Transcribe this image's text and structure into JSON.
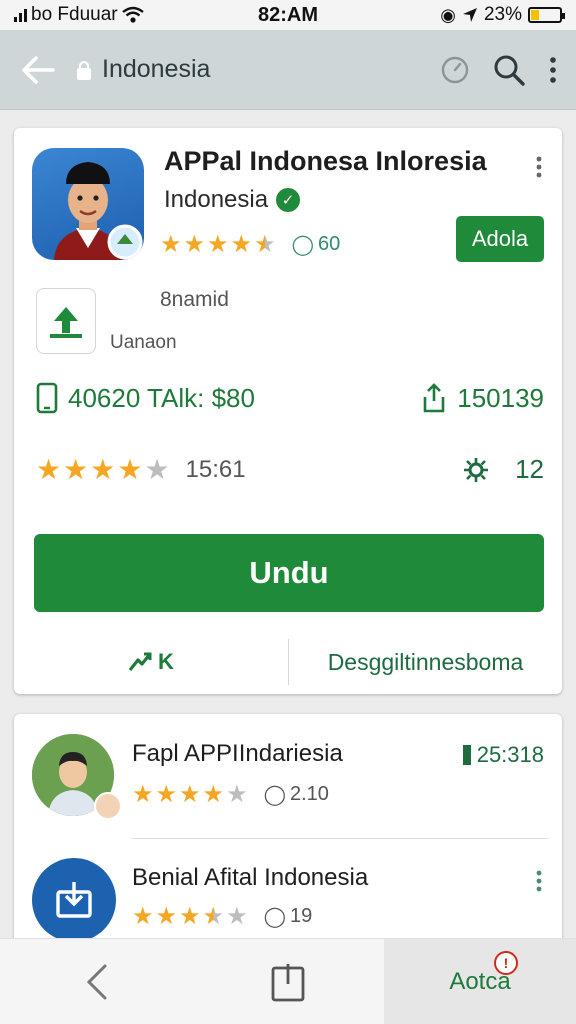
{
  "status_bar": {
    "carrier": "bo Fduuar",
    "time": "82:AM",
    "battery": "23%",
    "battery_level": 0.3
  },
  "app_bar": {
    "title": "Indonesia"
  },
  "app": {
    "name": "APPal Indonesa Inloresia",
    "developer": "Indonesia",
    "rating": 4.5,
    "rating_count": "60",
    "action_button": "Adola",
    "meta_line_1": "8namid",
    "meta_line_2": "Uanaon",
    "size_info": "40620 TAlk: $80",
    "downloads_info": "150139",
    "stat_rating": 4,
    "stat_value": "15:61",
    "reviews_count": "12",
    "install_button": "Undu",
    "footer_left": "K",
    "footer_right": "Desggiltinnesboma"
  },
  "list": {
    "items": [
      {
        "title": "Fapl APPIIndariesia",
        "rating": 4,
        "meta": "2.10",
        "time": "25:318"
      },
      {
        "title": "Benial Afital Indonesia",
        "rating": 3.5,
        "meta": "19"
      }
    ]
  },
  "bottom_nav": {
    "active_label": "Aotca",
    "badge": "!"
  },
  "colors": {
    "accent": "#1e8a3a",
    "star": "#f5a623",
    "app_bar": "#cfd6d8"
  }
}
